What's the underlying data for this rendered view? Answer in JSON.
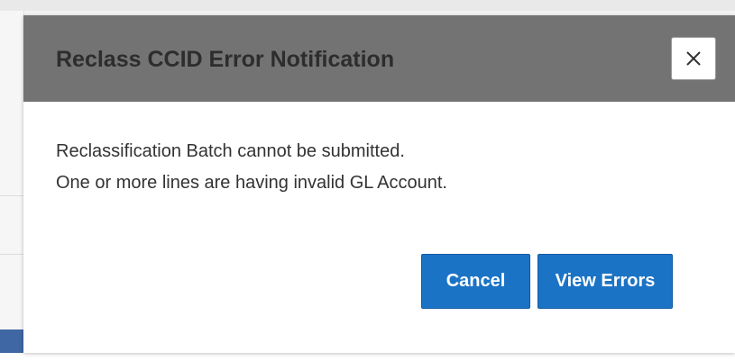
{
  "dialog": {
    "title": "Reclass CCID Error Notification",
    "close_icon": "close-icon",
    "message_line_1": "Reclassification Batch cannot be submitted.",
    "message_line_2": "One or more lines are having invalid GL Account.",
    "cancel_label": "Cancel",
    "view_errors_label": "View Errors"
  },
  "colors": {
    "header_bg": "#737373",
    "button_bg": "#1b73c5",
    "button_text": "#ffffff",
    "title_text": "#2d2d2d",
    "body_text": "#333333"
  }
}
